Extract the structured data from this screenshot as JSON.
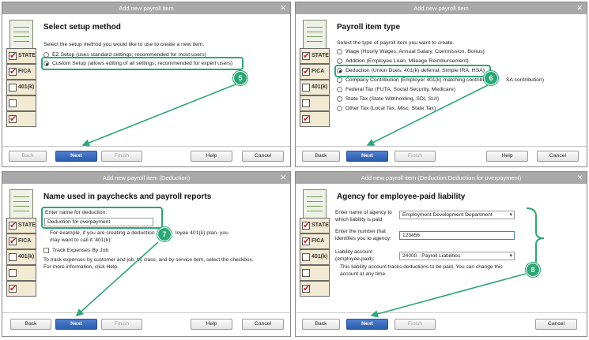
{
  "panels": {
    "p1": {
      "title": "Add new payroll item",
      "heading": "Select setup method",
      "instruction": "Select the setup method you would like to use to create a new item.",
      "options": [
        {
          "label": "EZ Setup (uses standard settings; recommended for most users)",
          "selected": false
        },
        {
          "label": "Custom Setup (allows editing of all settings; recommended for expert users)",
          "selected": true
        }
      ],
      "step": "5"
    },
    "p2": {
      "title": "Add new payroll item",
      "heading": "Payroll item type",
      "instruction": "Select the type of payroll item you want to create.",
      "options": [
        {
          "label": "Wage (Hourly Wages, Annual Salary, Commission, Bonus)",
          "selected": false
        },
        {
          "label": "Addition (Employee Loan, Mileage Reimbursement)",
          "selected": false
        },
        {
          "label": "Deduction (Union Dues, 401(k) deferral, Simple IRA, HSA)",
          "selected": true
        },
        {
          "label": "Company Contribution (Employer 401(k) matching contributi",
          "selected": false
        },
        {
          "label": "Federal Tax (FUTA, Social Security, Medicare)",
          "selected": false
        },
        {
          "label": "State Tax (State Withholding, SDI, SUI)",
          "selected": false
        },
        {
          "label": "Other Tax (Local Tax, Misc. State Tax)",
          "selected": false
        }
      ],
      "overflow_text": "SA contribution)",
      "step": "6"
    },
    "p3": {
      "title": "Add new payroll item (Deduction)",
      "heading": "Name used in paychecks and payroll reports",
      "field_label": "Enter name for deduction:",
      "field_value": "Deduction for overpayment",
      "example_line1": "For example, if you are creating a deduction",
      "example_line1b": "loyee 401(k) plan, you",
      "example_line2": "may want to call it '401(k)'.",
      "checkbox_label": "Track Expenses By Job",
      "help_text": "To track expenses by customer and job, by class, and by service item, select the checkbox.\nFor more information, click Help.",
      "step": "7"
    },
    "p4": {
      "title": "Add new payroll item (Deduction:Deduction for overpayment)",
      "heading": "Agency for employee-paid liability",
      "agency_label": "Enter name of agency to\nwhich liability is paid:",
      "agency_value": "Employment Development Department",
      "number_label": "Enter the number that\nidentifies you to agency:",
      "number_value": "123456",
      "account_label": "Liability account\n(employee-paid):",
      "account_value": "24000 · Payroll Liabilities",
      "account_note": "This liability account tracks deductions to be paid. You can change this\naccount at any time.",
      "step": "8"
    }
  },
  "art": {
    "labels": [
      "STATE",
      "FICA",
      "401(k)"
    ]
  },
  "buttons": {
    "back": "Back",
    "next": "Next",
    "finish": "Finish",
    "help": "Help",
    "cancel": "Cancel"
  },
  "colors": {
    "accent": "#2aa876",
    "primary_button": "#2a5db0",
    "title_bar": "#a9a9a9",
    "check_red": "#cc2222"
  }
}
